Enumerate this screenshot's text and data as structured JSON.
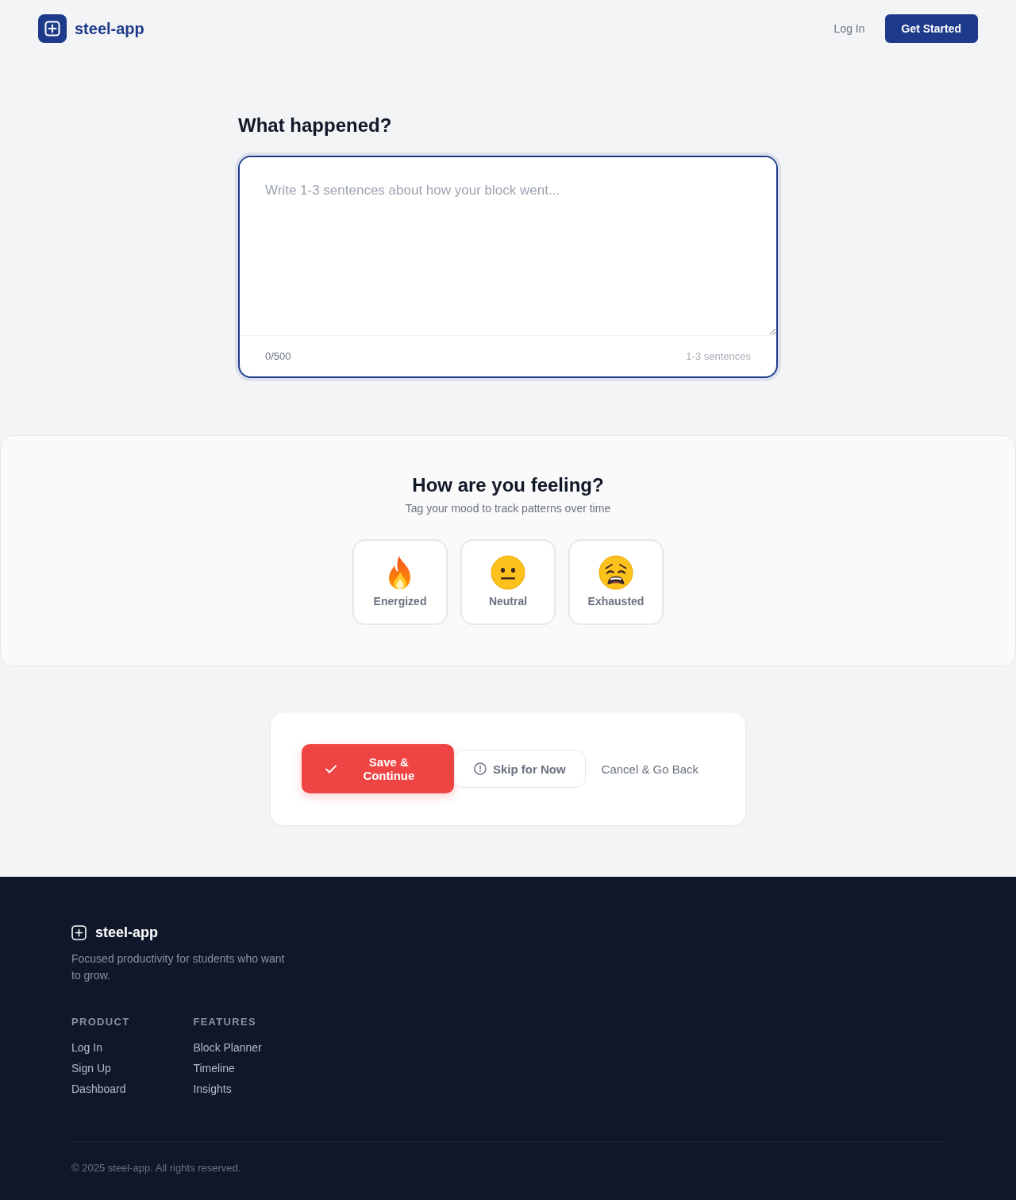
{
  "header": {
    "brand": "steel-app",
    "nav": [
      {
        "label": "Log In",
        "kind": "link"
      },
      {
        "label": "Get Started",
        "kind": "primary"
      }
    ]
  },
  "reflection": {
    "title": "What happened?",
    "focused": true,
    "placeholder": "Write 1-3 sentences about how your block went...",
    "count": "0/500",
    "hint": "1-3 sentences"
  },
  "mood": {
    "title": "How are you feeling?",
    "subtitle": "Tag your mood to track patterns over time",
    "options": [
      {
        "label": "Energized",
        "kind": "fire",
        "selected": false
      },
      {
        "label": "Neutral",
        "kind": "neutral",
        "selected": false
      },
      {
        "label": "Exhausted",
        "kind": "weary",
        "selected": false
      }
    ]
  },
  "actions": [
    {
      "label": "Save & Continue",
      "kind": "primary"
    },
    {
      "label": "Skip for Now",
      "kind": "secondary"
    },
    {
      "label": "Cancel & Go Back",
      "kind": "link"
    }
  ],
  "footer": {
    "brand": "steel-app",
    "tagline": "Focused productivity for students who want to grow.",
    "columns": [
      {
        "heading": "PRODUCT",
        "links": [
          "Log In",
          "Sign Up",
          "Dashboard"
        ]
      },
      {
        "heading": "FEATURES",
        "links": [
          "Block Planner",
          "Timeline",
          "Insights"
        ]
      }
    ],
    "copyright": "© 2025 steel-app. All rights reserved."
  }
}
